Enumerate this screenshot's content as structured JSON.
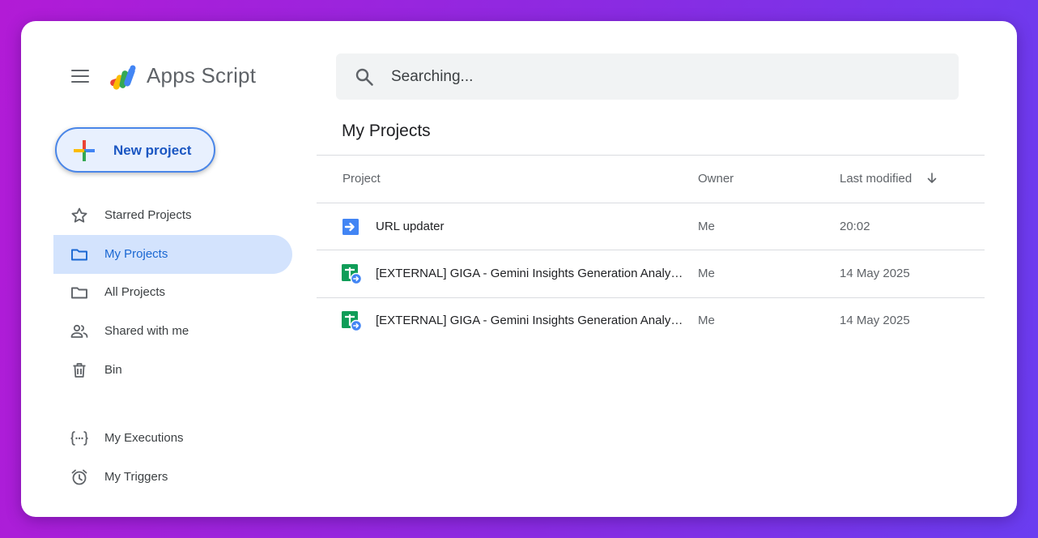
{
  "app": {
    "title": "Apps Script"
  },
  "new_project": {
    "label": "New project"
  },
  "nav": {
    "items": [
      {
        "label": "Starred Projects",
        "icon": "star-icon"
      },
      {
        "label": "My Projects",
        "icon": "folder-icon",
        "active": true
      },
      {
        "label": "All Projects",
        "icon": "folder-icon"
      },
      {
        "label": "Shared with me",
        "icon": "people-icon"
      },
      {
        "label": "Bin",
        "icon": "trash-icon"
      }
    ],
    "secondary": [
      {
        "label": "My Executions",
        "icon": "executions-icon"
      },
      {
        "label": "My Triggers",
        "icon": "alarm-clock-icon"
      }
    ]
  },
  "search": {
    "value": "",
    "placeholder": "Searching..."
  },
  "main": {
    "title": "My Projects",
    "columns": {
      "project": "Project",
      "owner": "Owner",
      "modified": "Last modified"
    },
    "rows": [
      {
        "name": "URL updater",
        "owner": "Me",
        "modified": "20:02",
        "icon": "standalone-script-icon"
      },
      {
        "name": "[EXTERNAL] GIGA - Gemini Insights Generation Analytics",
        "owner": "Me",
        "modified": "14 May 2025",
        "icon": "sheets-bound-script-icon"
      },
      {
        "name": "[EXTERNAL] GIGA - Gemini Insights Generation Analytics",
        "owner": "Me",
        "modified": "14 May 2025",
        "icon": "sheets-bound-script-icon"
      }
    ]
  },
  "colors": {
    "accent": "#1967d2",
    "active_bg": "#d3e3fd",
    "new_project_bg": "#e8f0fe",
    "sheets_green": "#0f9d58",
    "script_blue": "#4285f4"
  }
}
